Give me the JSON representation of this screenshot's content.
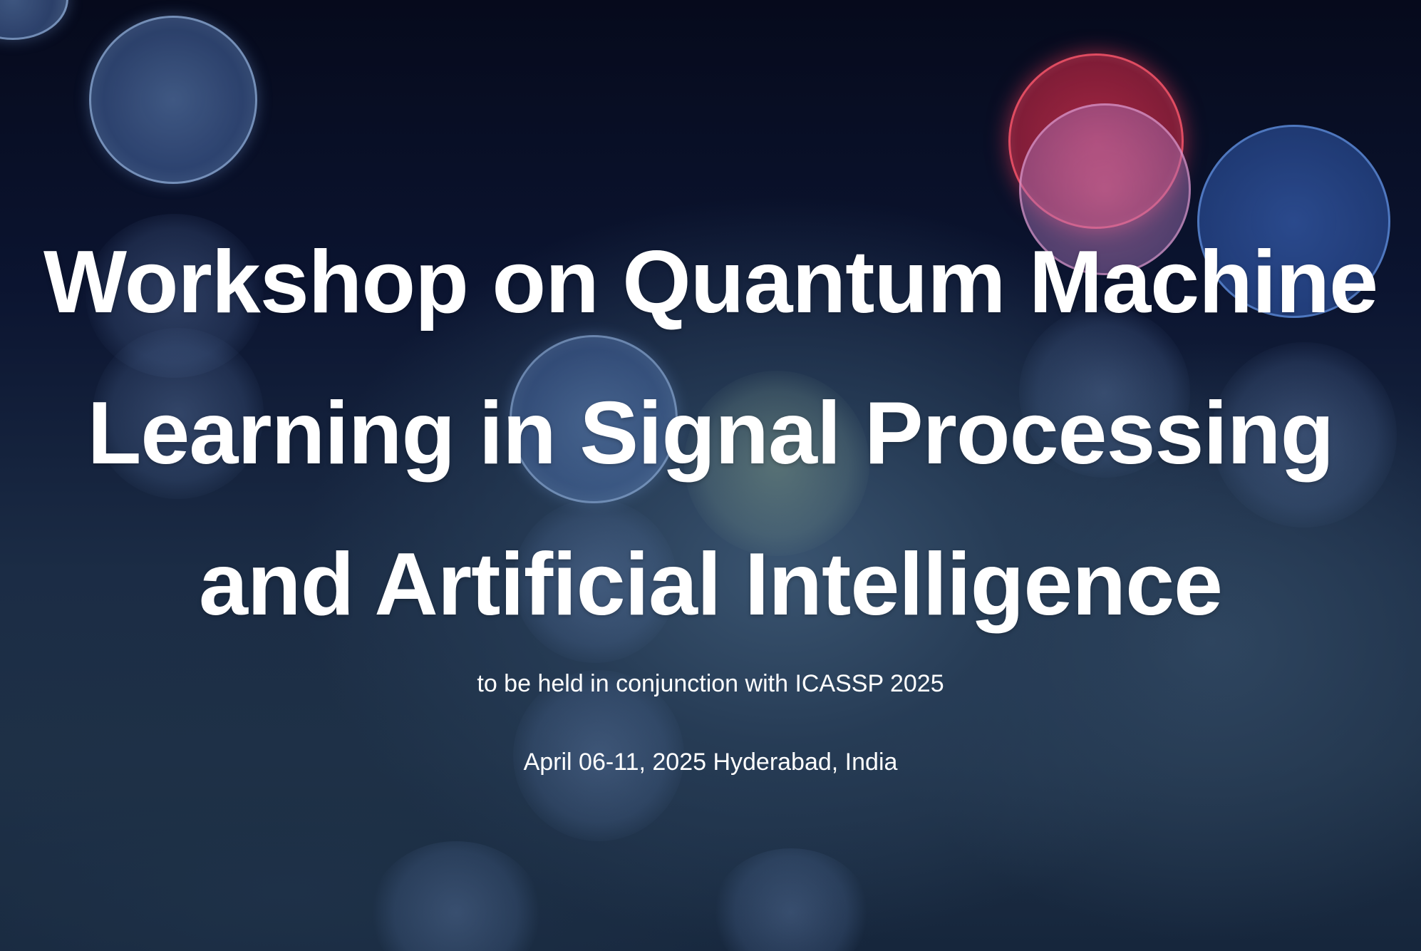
{
  "hero": {
    "title": "Workshop on Quantum Machine Learning in Signal Processing and Artificial Intelligence",
    "subtitle": "to be held in conjunction with ICASSP 2025",
    "date_location": "April 06-11, 2025 Hyderabad, India"
  },
  "colors": {
    "text": "#ffffff",
    "background_dark": "#060a1c",
    "background_mid": "#1e3046",
    "bokeh_red": "#e03250"
  }
}
